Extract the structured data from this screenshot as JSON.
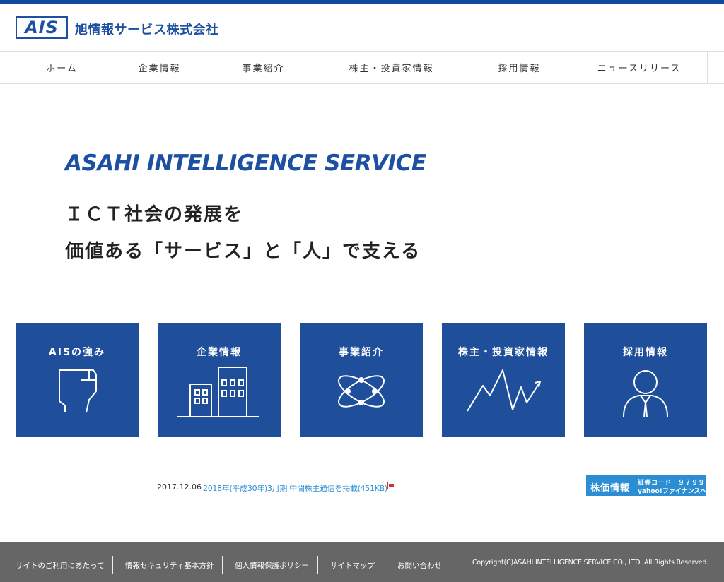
{
  "header": {
    "logo_text": "AIS",
    "company_name": "旭情報サービス株式会社"
  },
  "nav": {
    "items": [
      {
        "label": "ホーム"
      },
      {
        "label": "企業情報"
      },
      {
        "label": "事業紹介"
      },
      {
        "label": "株主・投資家情報"
      },
      {
        "label": "採用情報"
      },
      {
        "label": "ニュースリリース"
      }
    ]
  },
  "hero": {
    "english_title": "ASAHI INTELLIGENCE SERVICE",
    "tagline_line1": "ＩＣＴ社会の発展を",
    "tagline_line2": "価値ある「サービス」と「人」で支える"
  },
  "tiles": [
    {
      "label": "AISの強み",
      "icon": "fist-icon"
    },
    {
      "label": "企業情報",
      "icon": "buildings-icon"
    },
    {
      "label": "事業紹介",
      "icon": "network-icon"
    },
    {
      "label": "株主・投資家情報",
      "icon": "chart-line-icon"
    },
    {
      "label": "採用情報",
      "icon": "person-icon"
    }
  ],
  "news": {
    "date": "2017.12.06",
    "link_text": "2018年(平成30年)3月期 中間株主通信を掲載(451KB)",
    "link_icon": "pdf-icon"
  },
  "stock_banner": {
    "title": "株価情報",
    "code_line": "証券コード　９７９９",
    "yahoo_line": "yahoo!ファイナンスへ"
  },
  "footer": {
    "links": [
      {
        "label": "サイトのご利用にあたって"
      },
      {
        "label": "情報セキュリティ基本方針"
      },
      {
        "label": "個人情報保護ポリシー"
      },
      {
        "label": "サイトマップ"
      },
      {
        "label": "お問い合わせ"
      }
    ],
    "copyright": "Copyright(C)ASAHI INTELLIGENCE SERVICE CO., LTD. All Rights Reserved."
  },
  "colors": {
    "brand_blue": "#1f4f9b",
    "link_blue": "#2b8ed3",
    "footer_gray": "#666666"
  }
}
